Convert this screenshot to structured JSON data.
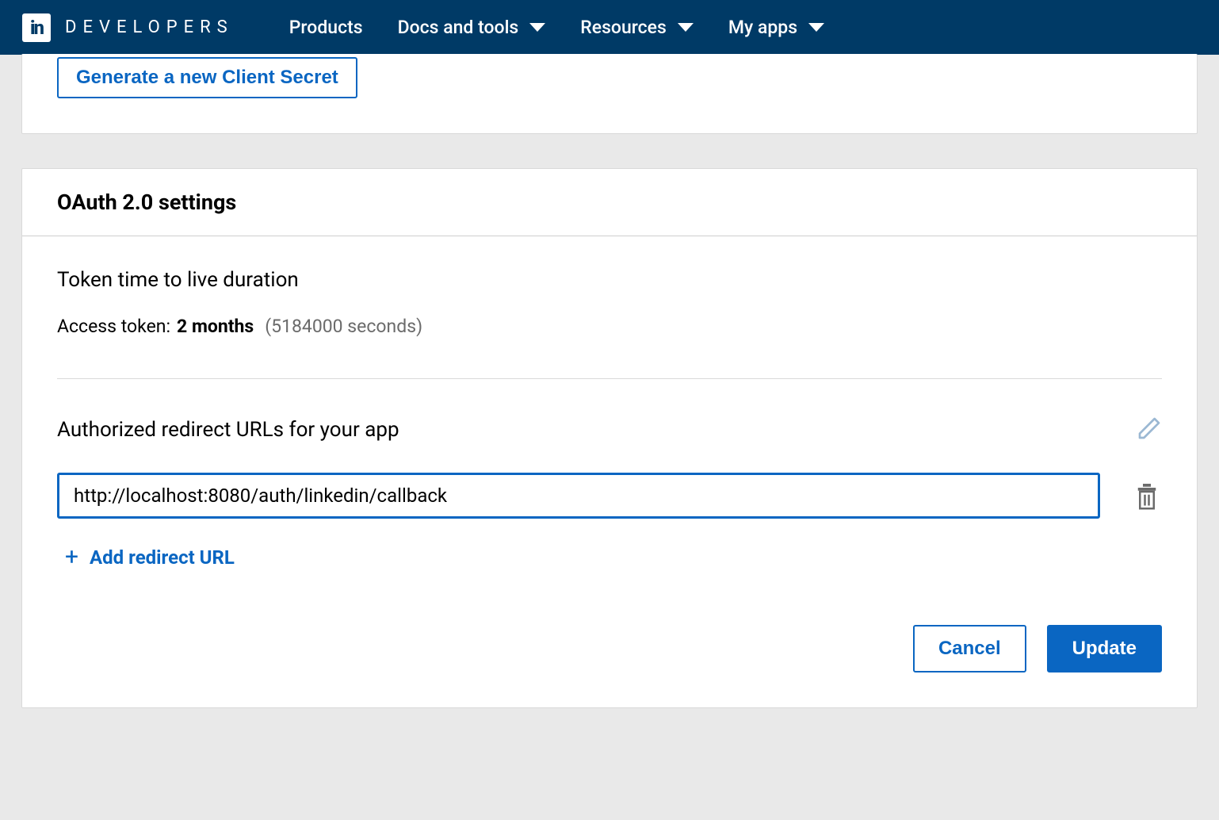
{
  "nav": {
    "brand_short": "in",
    "brand": "DEVELOPERS",
    "items": [
      {
        "label": "Products",
        "dropdown": false
      },
      {
        "label": "Docs and tools",
        "dropdown": true
      },
      {
        "label": "Resources",
        "dropdown": true
      },
      {
        "label": "My apps",
        "dropdown": true
      }
    ]
  },
  "client_secret": {
    "generate_button": "Generate a new Client Secret"
  },
  "oauth": {
    "heading": "OAuth 2.0 settings",
    "ttl_heading": "Token time to live duration",
    "access_token_label": "Access token:",
    "access_token_value": "2 months",
    "access_token_seconds": "(5184000 seconds)",
    "redirect_heading": "Authorized redirect URLs for your app",
    "redirect_urls": [
      "http://localhost:8080/auth/linkedin/callback"
    ],
    "add_redirect_label": "Add redirect URL",
    "cancel_label": "Cancel",
    "update_label": "Update"
  }
}
